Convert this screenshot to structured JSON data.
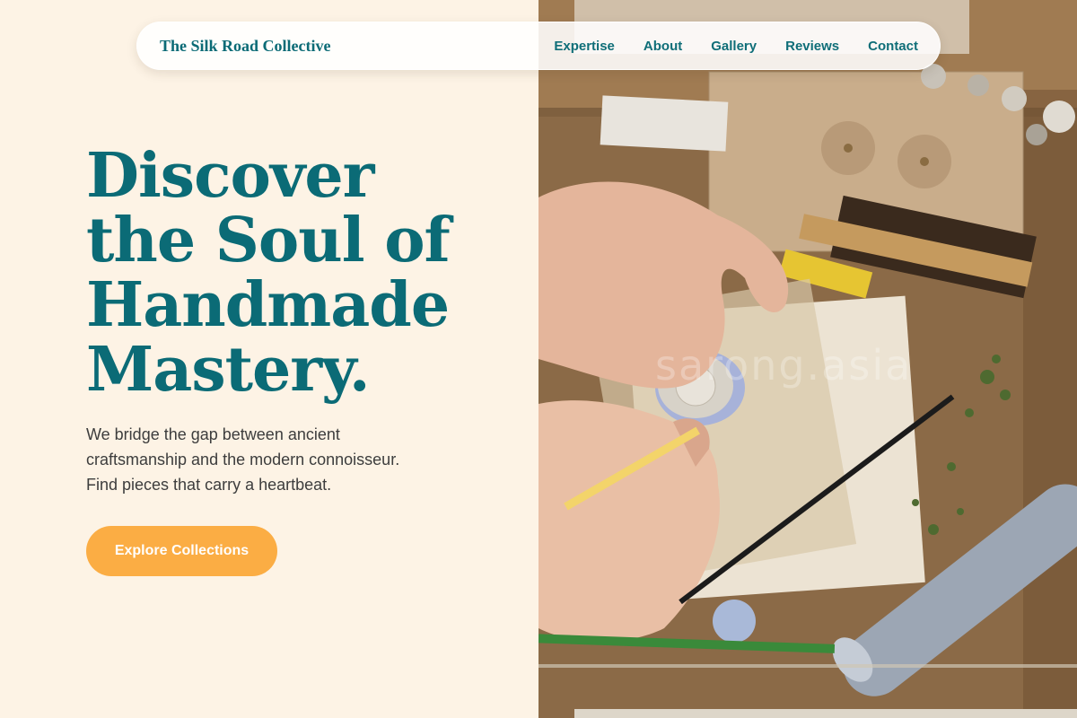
{
  "nav": {
    "brand": "The Silk Road Collective",
    "links": [
      "Expertise",
      "About",
      "Gallery",
      "Reviews",
      "Contact"
    ]
  },
  "hero": {
    "headline_lines": [
      "Discover",
      "the Soul of",
      "Handmade",
      "Mastery."
    ],
    "subtext_lines": [
      "We bridge the gap between ancient",
      "craftsmanship and the modern connoisseur.",
      "Find pieces that carry a heartbeat."
    ],
    "cta_label": "Explore Collections"
  },
  "photo": {
    "watermark": "sarong.asia"
  },
  "colors": {
    "background": "#fdf3e5",
    "primary_teal": "#0b6b76",
    "cta_orange": "#fbad44",
    "body_text": "#3d3d3d"
  }
}
